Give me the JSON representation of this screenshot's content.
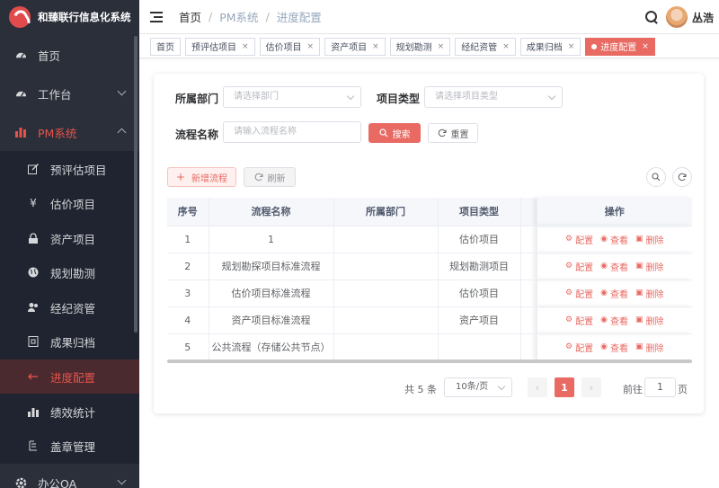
{
  "app": {
    "title": "和臻联行信息化系统"
  },
  "sidebar": {
    "items": [
      {
        "label": "首页",
        "icon": "dashboard-icon"
      },
      {
        "label": "工作台",
        "icon": "dashboard-icon"
      },
      {
        "label": "PM系统",
        "icon": "bar-chart-icon"
      },
      {
        "label": "预评估项目",
        "icon": "edit-icon"
      },
      {
        "label": "估价项目",
        "icon": "yen-icon"
      },
      {
        "label": "资产项目",
        "icon": "lock-icon"
      },
      {
        "label": "规划勘测",
        "icon": "globe-icon"
      },
      {
        "label": "经纪资管",
        "icon": "people-icon"
      },
      {
        "label": "成果归档",
        "icon": "archive-icon"
      },
      {
        "label": "进度配置",
        "icon": "progress-icon"
      },
      {
        "label": "绩效统计",
        "icon": "stats-icon"
      },
      {
        "label": "盖章管理",
        "icon": "stamp-icon"
      },
      {
        "label": "办公OA",
        "icon": "gear-icon"
      }
    ]
  },
  "header": {
    "breadcrumb": [
      "首页",
      "PM系统",
      "进度配置"
    ],
    "user_name": "丛浩"
  },
  "tags": [
    {
      "label": "首页",
      "closable": false,
      "active": false
    },
    {
      "label": "预评估项目",
      "closable": true,
      "active": false
    },
    {
      "label": "估价项目",
      "closable": true,
      "active": false
    },
    {
      "label": "资产项目",
      "closable": true,
      "active": false
    },
    {
      "label": "规划勘测",
      "closable": true,
      "active": false
    },
    {
      "label": "经纪资管",
      "closable": true,
      "active": false
    },
    {
      "label": "成果归档",
      "closable": true,
      "active": false
    },
    {
      "label": "进度配置",
      "closable": true,
      "active": true
    }
  ],
  "close_glyph": "×",
  "filters": {
    "dept_label": "所属部门",
    "dept_placeholder": "请选择部门",
    "type_label": "项目类型",
    "type_placeholder": "请选择项目类型",
    "name_label": "流程名称",
    "name_placeholder": "请输入流程名称",
    "search_label": "搜索",
    "reset_label": "重置"
  },
  "toolbar": {
    "add_label": "新增流程",
    "refresh_label": "刷新"
  },
  "table": {
    "columns": [
      "序号",
      "流程名称",
      "所属部门",
      "项目类型",
      "",
      "操作"
    ],
    "rows": [
      {
        "no": "1",
        "name": "1",
        "dept": "",
        "type": "估价项目"
      },
      {
        "no": "2",
        "name": "规划勘探项目标准流程",
        "dept": "",
        "type": "规划勘测项目"
      },
      {
        "no": "3",
        "name": "估价项目标准流程",
        "dept": "",
        "type": "估价项目"
      },
      {
        "no": "4",
        "name": "资产项目标准流程",
        "dept": "",
        "type": "资产项目"
      },
      {
        "no": "5",
        "name": "公共流程（存储公共节点）",
        "dept": "",
        "type": ""
      }
    ],
    "actions": [
      "配置",
      "查看",
      "删除"
    ]
  },
  "pagination": {
    "total_text": "共 5 条",
    "page_size": "10条/页",
    "current_page": "1",
    "goto_label": "前往",
    "goto_value": "1",
    "page_suffix": "页"
  },
  "colors": {
    "accent": "#e86a62",
    "sidebar_bg": "#2b2f3a"
  }
}
